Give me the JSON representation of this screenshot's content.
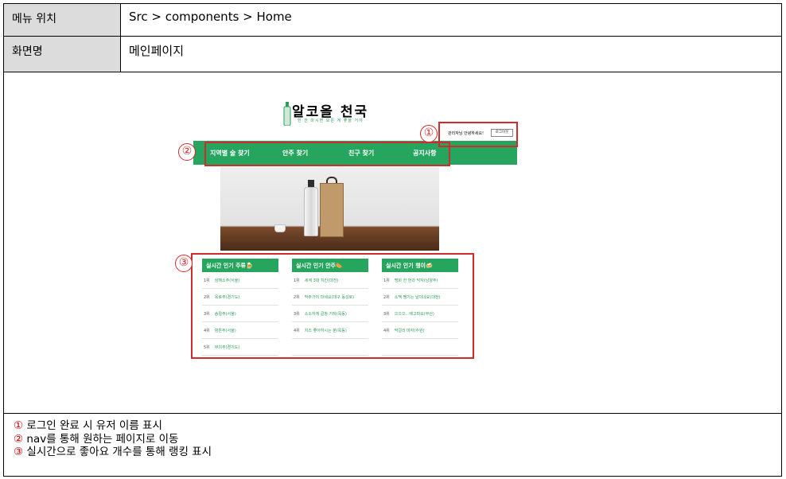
{
  "spec": {
    "menu_label": "메뉴 위치",
    "menu_value": "Src > components > Home",
    "screen_label": "화면명",
    "screen_value": "메인페이지"
  },
  "mockup": {
    "logo_title": "알코올 천국",
    "logo_sub": "한 잔 마시면 모든 게 좋을 거야",
    "login_text": "관리자님 안녕하세요!",
    "logout_label": "로그아웃",
    "nav": [
      "지역별 술 찾기",
      "안주 찾기",
      "친구 찾기",
      "공지사항"
    ],
    "rankings": [
      {
        "title": "실시간 인기 주류🍺",
        "items": [
          {
            "rank": "1위",
            "name": "삼해소주(서울)"
          },
          {
            "rank": "2위",
            "name": "옥로주(경기도)"
          },
          {
            "rank": "3위",
            "name": "송절주(서울)"
          },
          {
            "rank": "4위",
            "name": "향온주(서울)"
          },
          {
            "rank": "5위",
            "name": "부의주(경기도)"
          }
        ]
      },
      {
        "title": "실시간 인기 안주🌭",
        "items": [
          {
            "rank": "1위",
            "name": "세계 3대 치킨(대전)"
          },
          {
            "rank": "2위",
            "name": "막주가지 마세요(대구 동성로)"
          },
          {
            "rank": "3위",
            "name": "소소하게 곱창 가자(목동)"
          },
          {
            "rank": "4위",
            "name": "치즈 좋아하시는 분(옥동)"
          }
        ]
      },
      {
        "title": "실시간 인기 챙이🍻",
        "items": [
          {
            "rank": "1위",
            "name": "명희 한 번과 닥자(남양주)"
          },
          {
            "rank": "2위",
            "name": "소맥 땡기는 날이네요(대전)"
          },
          {
            "rank": "3위",
            "name": "으으으.. 배고파요(부산)"
          },
          {
            "rank": "4위",
            "name": "막걸리 마자(수원)"
          }
        ]
      }
    ],
    "markers": [
      "①",
      "②",
      "③"
    ]
  },
  "notes": [
    {
      "num": "①",
      "text": "로그인 완료 시 유저 이름 표시"
    },
    {
      "num": "②",
      "text": "nav를 통해 원하는 페이지로 이동"
    },
    {
      "num": "③",
      "text": "실시간으로 좋아요 개수를 통해 랭킹 표시"
    }
  ],
  "colors": {
    "accent_green": "#25a55e",
    "annotation_red": "#d12b2b"
  }
}
